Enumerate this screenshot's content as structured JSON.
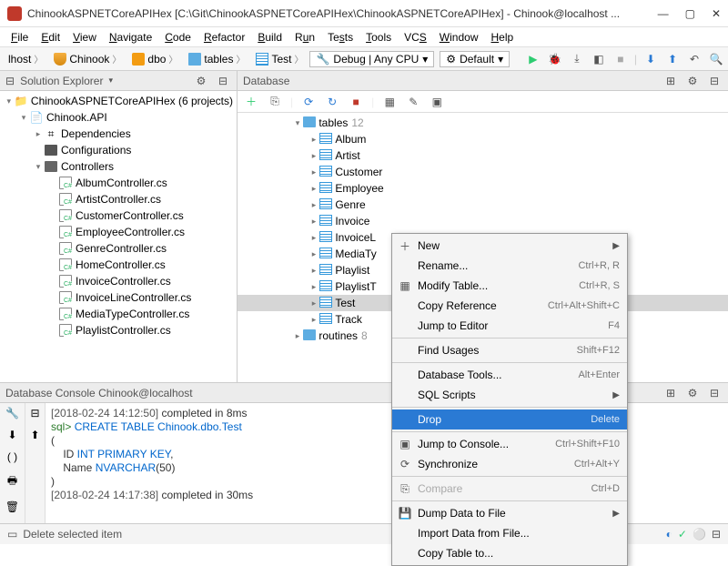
{
  "window": {
    "title": "ChinookASPNETCoreAPIHex [C:\\Git\\ChinookASPNETCoreAPIHex\\ChinookASPNETCoreAPIHex] - Chinook@localhost ..."
  },
  "menubar": [
    "File",
    "Edit",
    "View",
    "Navigate",
    "Code",
    "Refactor",
    "Build",
    "Run",
    "Tests",
    "Tools",
    "VCS",
    "Window",
    "Help"
  ],
  "breadcrumb": {
    "items": [
      "lhost",
      "Chinook",
      "dbo",
      "tables",
      "Test"
    ],
    "config": "Debug | Any CPU",
    "profile": "Default"
  },
  "solution_panel": {
    "title": "Solution Explorer",
    "root": "ChinookASPNETCoreAPIHex (6 projects)",
    "project": "Chinook.API",
    "nodes": [
      "Dependencies",
      "Configurations",
      "Controllers"
    ],
    "controllers": [
      "AlbumController.cs",
      "ArtistController.cs",
      "CustomerController.cs",
      "EmployeeController.cs",
      "GenreController.cs",
      "HomeController.cs",
      "InvoiceController.cs",
      "InvoiceLineController.cs",
      "MediaTypeController.cs",
      "PlaylistController.cs"
    ]
  },
  "database_panel": {
    "title": "Database",
    "tables_label": "tables",
    "tables_count": "12",
    "tables": [
      "Album",
      "Artist",
      "Customer",
      "Employee",
      "Genre",
      "Invoice",
      "InvoiceL",
      "MediaTy",
      "Playlist",
      "PlaylistT",
      "Test",
      "Track"
    ],
    "routines_label": "routines",
    "routines_count": "8",
    "selected": "Test"
  },
  "context_menu": [
    {
      "icon": "＋",
      "label": "New",
      "shortcut": "",
      "arrow": true
    },
    {
      "label": "Rename...",
      "shortcut": "Ctrl+R, R"
    },
    {
      "icon": "▦",
      "label": "Modify Table...",
      "shortcut": "Ctrl+R, S"
    },
    {
      "label": "Copy Reference",
      "shortcut": "Ctrl+Alt+Shift+C"
    },
    {
      "label": "Jump to Editor",
      "shortcut": "F4"
    },
    {
      "sep": true
    },
    {
      "label": "Find Usages",
      "shortcut": "Shift+F12"
    },
    {
      "sep": true
    },
    {
      "label": "Database Tools...",
      "shortcut": "Alt+Enter"
    },
    {
      "label": "SQL Scripts",
      "shortcut": "",
      "arrow": true
    },
    {
      "sep": true
    },
    {
      "label": "Drop",
      "shortcut": "Delete",
      "highlight": true
    },
    {
      "sep": true
    },
    {
      "icon": "▣",
      "label": "Jump to Console...",
      "shortcut": "Ctrl+Shift+F10"
    },
    {
      "icon": "⟳",
      "label": "Synchronize",
      "shortcut": "Ctrl+Alt+Y"
    },
    {
      "sep": true
    },
    {
      "icon": "⎘",
      "label": "Compare",
      "shortcut": "Ctrl+D",
      "disabled": true
    },
    {
      "sep": true
    },
    {
      "icon": "💾",
      "label": "Dump Data to File",
      "shortcut": "",
      "arrow": true
    },
    {
      "label": "Import Data from File..."
    },
    {
      "label": "Copy Table to..."
    }
  ],
  "console": {
    "title": "Database Console Chinook@localhost",
    "line1_ts": "[2018-02-24 14:12:50]",
    "line1_rest": " completed in 8ms",
    "prompt": "sql> ",
    "stmt": "CREATE TABLE Chinook.dbo.Test",
    "line3": "(",
    "line4a": "    ID ",
    "line4b": "INT PRIMARY KEY",
    "line4c": ",",
    "line5a": "    Name ",
    "line5b": "NVARCHAR",
    "line5c": "(50)",
    "line6": ")",
    "line7_ts": "[2018-02-24 14:17:38]",
    "line7_rest": " completed in 30ms"
  },
  "status": {
    "text": "Delete selected item"
  }
}
